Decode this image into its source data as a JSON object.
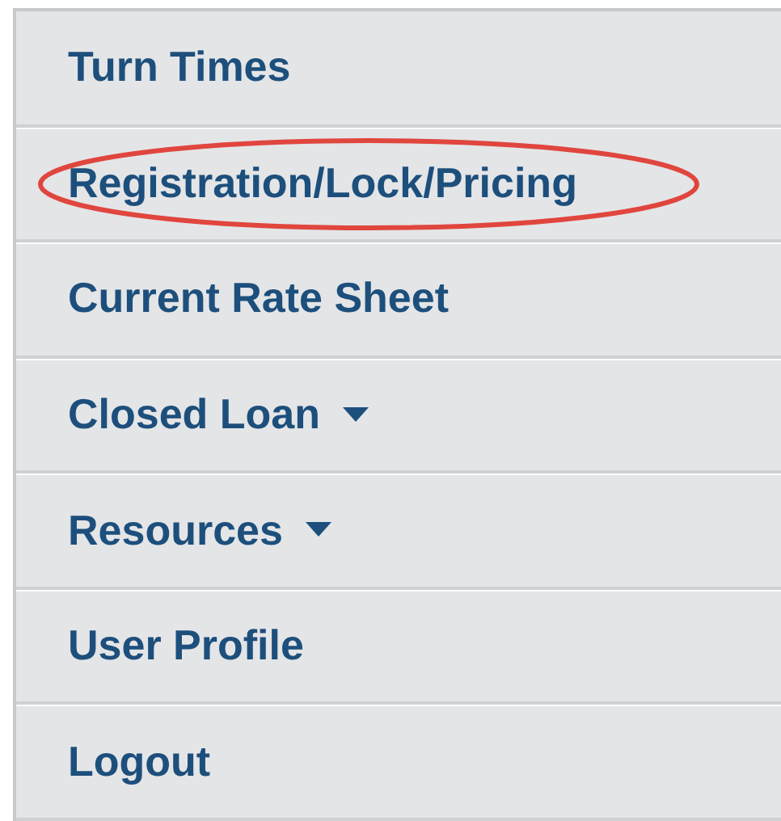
{
  "menu": {
    "items": [
      {
        "label": "Turn Times",
        "has_dropdown": false,
        "circled": false
      },
      {
        "label": "Registration/Lock/Pricing",
        "has_dropdown": false,
        "circled": true
      },
      {
        "label": "Current Rate Sheet",
        "has_dropdown": false,
        "circled": false
      },
      {
        "label": "Closed Loan",
        "has_dropdown": true,
        "circled": false
      },
      {
        "label": "Resources",
        "has_dropdown": true,
        "circled": false
      },
      {
        "label": "User Profile",
        "has_dropdown": false,
        "circled": false
      },
      {
        "label": "Logout",
        "has_dropdown": false,
        "circled": false
      }
    ]
  }
}
